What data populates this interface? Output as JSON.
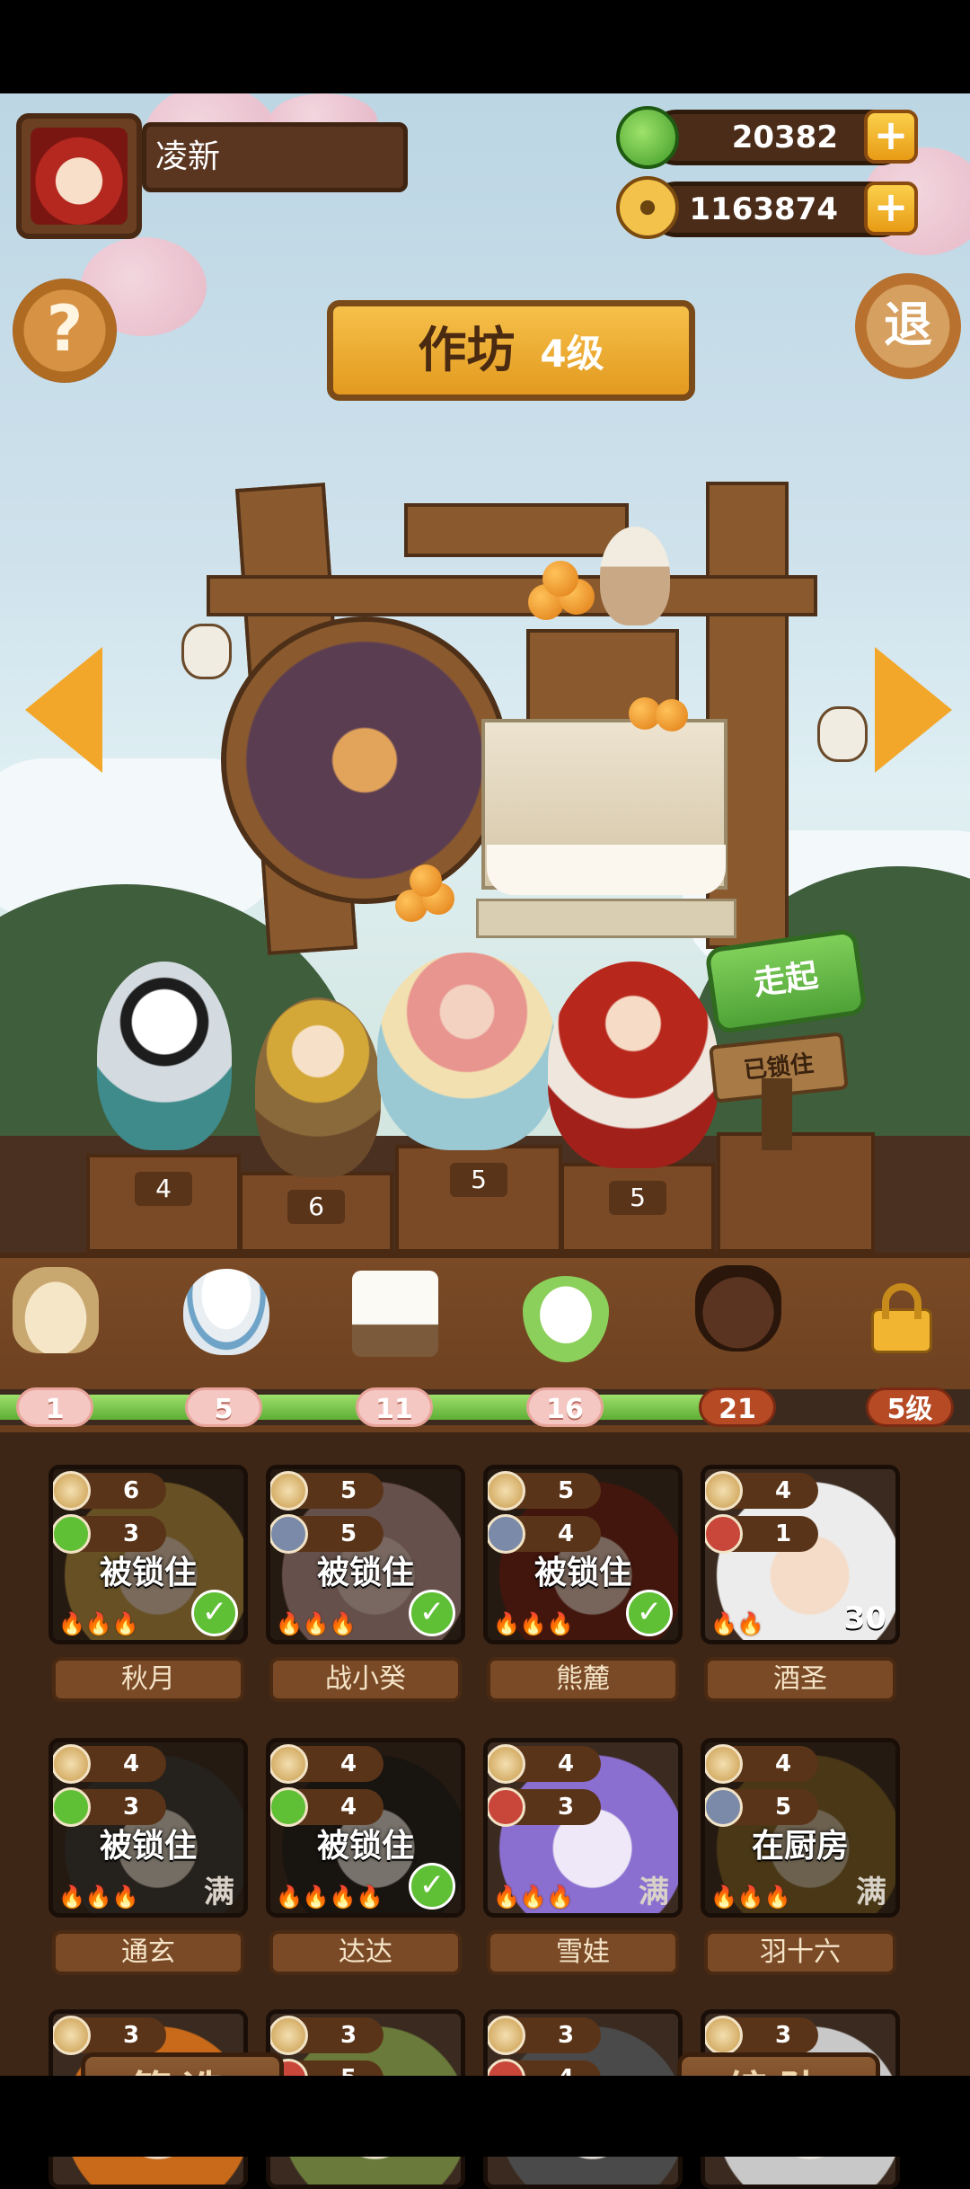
{
  "player": {
    "name": "凌新"
  },
  "currency": {
    "jade": "20382",
    "coins": "1163874"
  },
  "header": {
    "help_glyph": "?",
    "exit_label": "退"
  },
  "workshop": {
    "title": "作坊",
    "level": "4级"
  },
  "signs": {
    "go": "走起",
    "locked": "已锁住"
  },
  "pedestals": [
    "4",
    "6",
    "5",
    "5"
  ],
  "ingredients": [
    {
      "icon": "soybean-sack-icon",
      "level": "1"
    },
    {
      "icon": "rice-bowl-icon",
      "level": "5"
    },
    {
      "icon": "tofu-plate-icon",
      "level": "11"
    },
    {
      "icon": "rice-leaf-icon",
      "level": "16"
    },
    {
      "icon": "wine-jar-icon",
      "level": "21"
    },
    {
      "icon": "padlock-icon",
      "level": "5级"
    }
  ],
  "roster": [
    {
      "name": "秋月",
      "stat1": "6",
      "stat2": "3",
      "stat2_icon": "cabbage-icon",
      "state": "被锁住",
      "flames": "🔥🔥🔥",
      "badge": "check"
    },
    {
      "name": "战小癸",
      "stat1": "5",
      "stat2": "5",
      "stat2_icon": "fish-icon",
      "state": "被锁住",
      "flames": "🔥🔥🔥",
      "badge": "check"
    },
    {
      "name": "熊麓",
      "stat1": "5",
      "stat2": "4",
      "stat2_icon": "fish-icon",
      "state": "被锁住",
      "flames": "🔥🔥🔥",
      "badge": "check"
    },
    {
      "name": "酒圣",
      "stat1": "4",
      "stat2": "1",
      "stat2_icon": "meat-icon",
      "state": "",
      "flames": "🔥🔥",
      "badge": "30"
    },
    {
      "name": "通玄",
      "stat1": "4",
      "stat2": "3",
      "stat2_icon": "cabbage-icon",
      "state": "被锁住",
      "flames": "🔥🔥🔥",
      "badge": "满"
    },
    {
      "name": "达达",
      "stat1": "4",
      "stat2": "4",
      "stat2_icon": "cabbage-icon",
      "state": "被锁住",
      "flames": "🔥🔥🔥🔥",
      "badge": "check"
    },
    {
      "name": "雪娃",
      "stat1": "4",
      "stat2": "3",
      "stat2_icon": "meat-icon",
      "state": "",
      "flames": "🔥🔥🔥",
      "badge": "满"
    },
    {
      "name": "羽十六",
      "stat1": "4",
      "stat2": "5",
      "stat2_icon": "fish-icon",
      "state": "在厨房",
      "flames": "🔥🔥🔥",
      "badge": "满"
    },
    {
      "name": "",
      "stat1": "3",
      "stat2": "",
      "stat2_icon": "cabbage-icon",
      "state": "",
      "flames": "",
      "badge": ""
    },
    {
      "name": "",
      "stat1": "3",
      "stat2": "5",
      "stat2_icon": "meat-icon",
      "state": "",
      "flames": "",
      "badge": ""
    },
    {
      "name": "",
      "stat1": "3",
      "stat2": "4",
      "stat2_icon": "meat-icon",
      "state": "",
      "flames": "",
      "badge": ""
    },
    {
      "name": "",
      "stat1": "3",
      "stat2": "",
      "stat2_icon": "fish-icon",
      "state": "",
      "flames": "",
      "badge": ""
    }
  ],
  "buttons": {
    "filter": "筛选",
    "team": "编队"
  },
  "colors": {
    "accent_gold": "#f2a72a",
    "wood": "#7a4a26",
    "progress_green": "#5fae36",
    "check_green": "#5fbf35"
  }
}
